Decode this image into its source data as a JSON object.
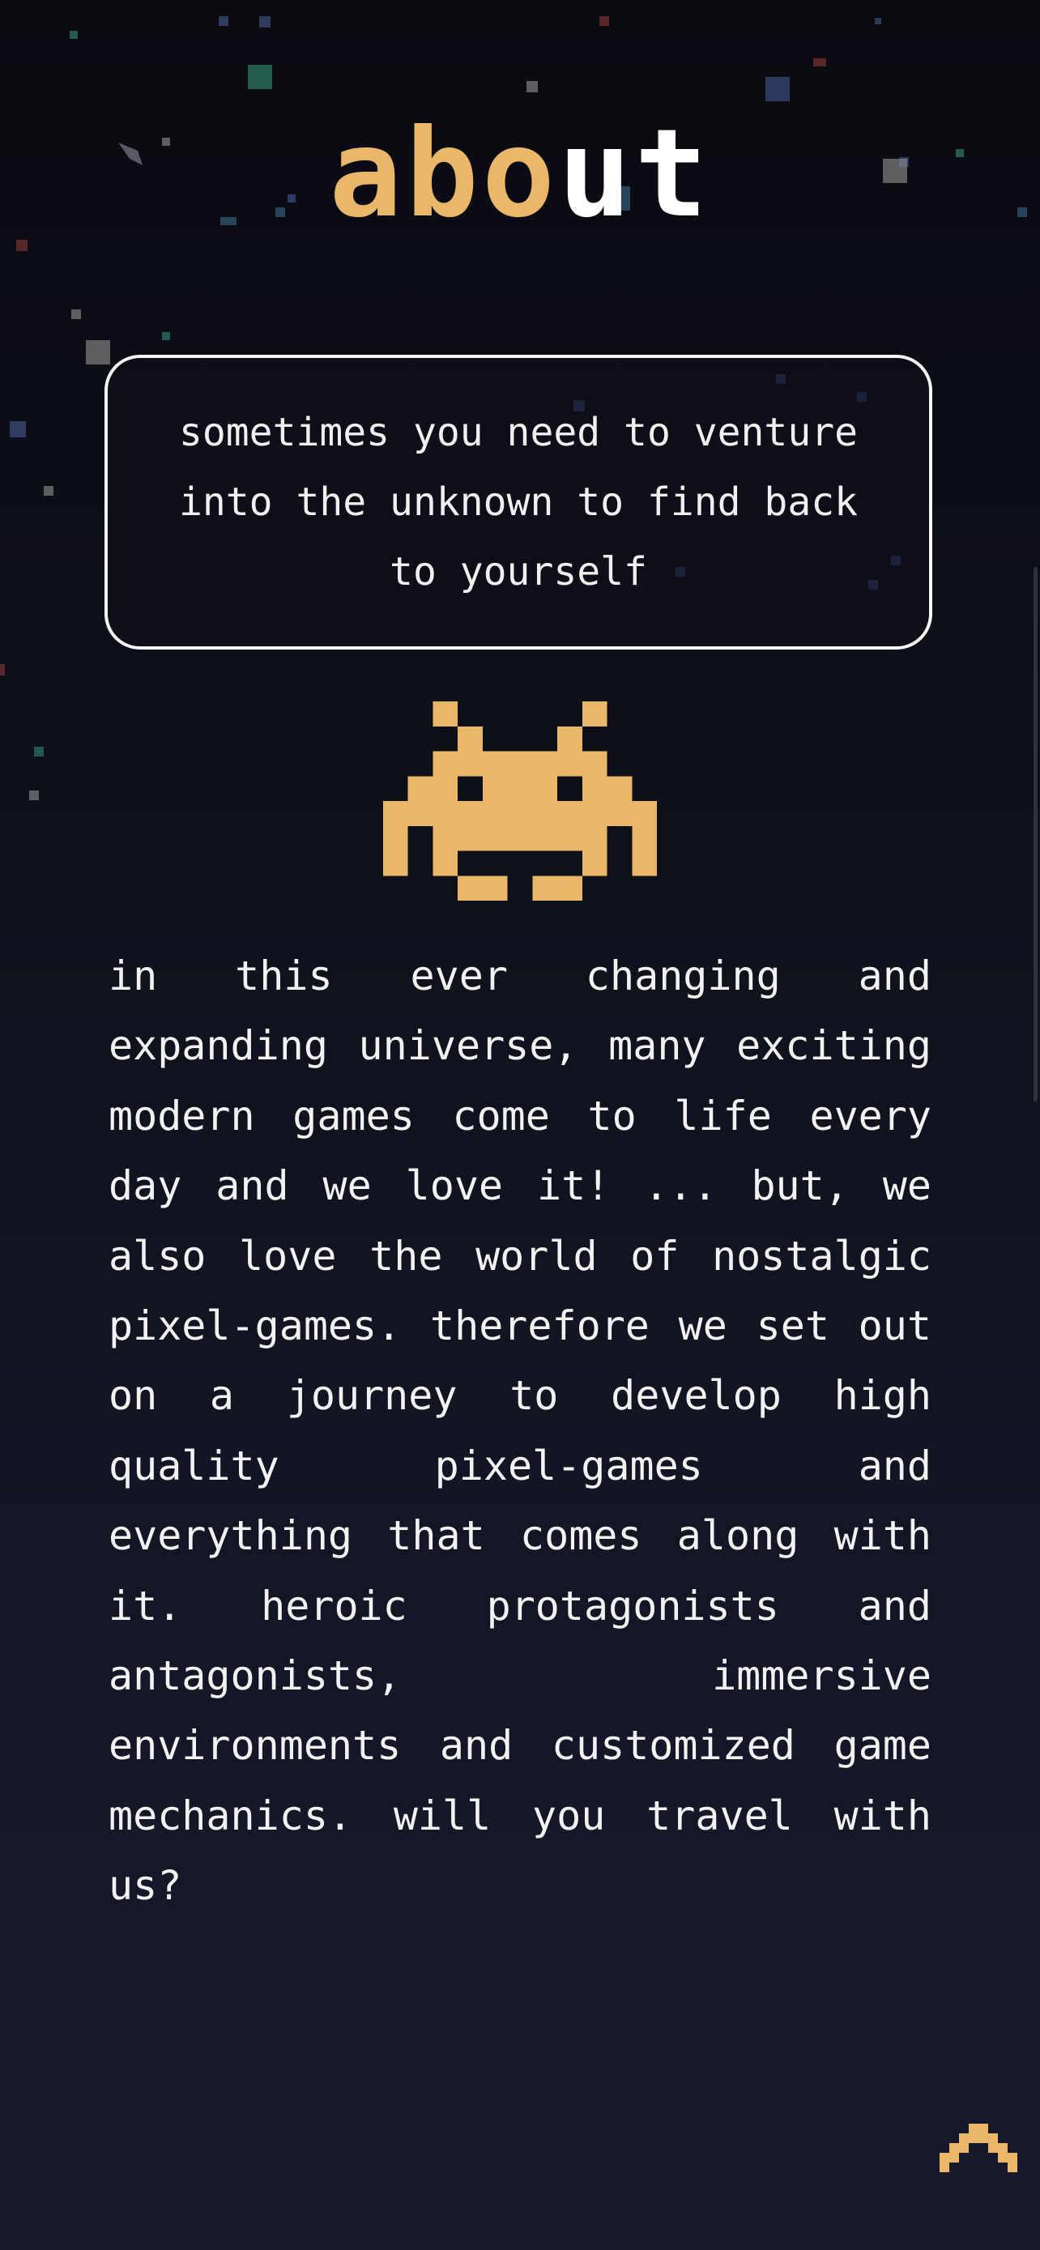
{
  "header": {
    "title_accent": "abo",
    "title_rest": "ut"
  },
  "quote": {
    "text": "sometimes you need to venture into the unknown to find back to yourself"
  },
  "mascot": {
    "icon": "space-invader-icon",
    "color": "#e9b767"
  },
  "about": {
    "body": "in this ever changing and expanding universe, many exciting modern games come to life every day and we love it! ... but, we also love the world of nostalgic pixel-games. therefore we set out on a journey to develop high quality pixel-games and everything that comes along with it. heroic protagonists and antagonists, immersive environments and customized game mechanics. will you travel with us?"
  },
  "scroll_top": {
    "icon": "chevron-up-icon"
  },
  "colors": {
    "accent": "#e9b767",
    "background": "#0e1019",
    "text": "#f2f2f2"
  }
}
